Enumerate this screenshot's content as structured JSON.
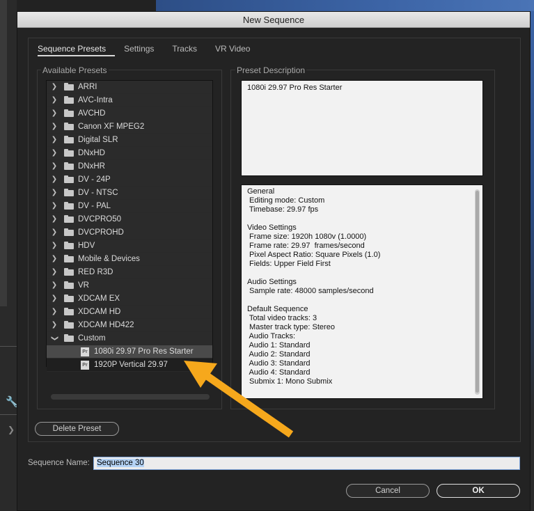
{
  "dialog": {
    "title": "New Sequence"
  },
  "tabs": [
    {
      "label": "Sequence Presets",
      "active": true
    },
    {
      "label": "Settings",
      "active": false
    },
    {
      "label": "Tracks",
      "active": false
    },
    {
      "label": "VR Video",
      "active": false
    }
  ],
  "presets": {
    "group_label": "Available Presets",
    "folders": [
      "ARRI",
      "AVC-Intra",
      "AVCHD",
      "Canon XF MPEG2",
      "Digital SLR",
      "DNxHD",
      "DNxHR",
      "DV - 24P",
      "DV - NTSC",
      "DV - PAL",
      "DVCPRO50",
      "DVCPROHD",
      "HDV",
      "Mobile & Devices",
      "RED R3D",
      "VR",
      "XDCAM EX",
      "XDCAM HD",
      "XDCAM HD422"
    ],
    "expanded_folder": "Custom",
    "custom_items": [
      {
        "label": "1080i 29.97 Pro Res Starter",
        "selected": true,
        "badge": "Pr"
      },
      {
        "label": "1920P Vertical 29.97",
        "selected": false,
        "badge": "Pr"
      }
    ]
  },
  "description": {
    "group_label": "Preset Description",
    "preset_name": "1080i 29.97 Pro Res Starter",
    "details": [
      "General",
      " Editing mode: Custom",
      " Timebase: 29.97 fps",
      "",
      "Video Settings",
      " Frame size: 1920h 1080v (1.0000)",
      " Frame rate: 29.97  frames/second",
      " Pixel Aspect Ratio: Square Pixels (1.0)",
      " Fields: Upper Field First",
      "",
      "Audio Settings",
      " Sample rate: 48000 samples/second",
      "",
      "Default Sequence",
      " Total video tracks: 3",
      " Master track type: Stereo",
      " Audio Tracks:",
      " Audio 1: Standard",
      " Audio 2: Standard",
      " Audio 3: Standard",
      " Audio 4: Standard",
      " Submix 1: Mono Submix"
    ]
  },
  "buttons": {
    "delete_preset": "Delete Preset",
    "cancel": "Cancel",
    "ok": "OK"
  },
  "sequence_name": {
    "label": "Sequence Name:",
    "value": "Sequence 30"
  },
  "annotation": {
    "arrow_color": "#f6a81c"
  },
  "background": {
    "wrench_icon": "wrench-icon",
    "chevron_icon": "chevron-right-icon"
  }
}
